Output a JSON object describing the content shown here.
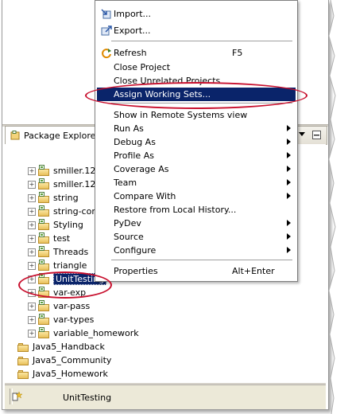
{
  "package_explorer": {
    "tab_label": "Package Explorer",
    "projects": [
      {
        "label": "smiller.12V",
        "type": "pydev"
      },
      {
        "label": "smiller.12V",
        "type": "pydev"
      },
      {
        "label": "string",
        "type": "java"
      },
      {
        "label": "string-cor",
        "type": "java"
      },
      {
        "label": "Styling",
        "type": "java"
      },
      {
        "label": "test",
        "type": "pydev"
      },
      {
        "label": "Threads",
        "type": "java"
      },
      {
        "label": "triangle",
        "type": "java"
      },
      {
        "label": "UnitTesting",
        "type": "java",
        "selected": true
      },
      {
        "label": "var-exp",
        "type": "java"
      },
      {
        "label": "var-pass",
        "type": "java"
      },
      {
        "label": "var-types",
        "type": "java"
      },
      {
        "label": "variable_homework",
        "type": "java"
      }
    ],
    "working_sets": [
      "Java5_Handback",
      "Java5_Community",
      "Java5_Homework"
    ]
  },
  "status_bar": {
    "text": "UnitTesting"
  },
  "context_menu": {
    "items": [
      {
        "label": "Import...",
        "icon": "import-icon"
      },
      {
        "label": "Export...",
        "icon": "export-icon"
      },
      {
        "label": "Refresh",
        "shortcut": "F5",
        "icon": "refresh-icon"
      },
      {
        "label": "Close Project"
      },
      {
        "label": "Close Unrelated Projects"
      },
      {
        "label": "Assign Working Sets...",
        "highlighted": true
      },
      {
        "label": "Show in Remote Systems view"
      },
      {
        "label": "Run As",
        "submenu": true
      },
      {
        "label": "Debug As",
        "submenu": true
      },
      {
        "label": "Profile As",
        "submenu": true
      },
      {
        "label": "Coverage As",
        "submenu": true
      },
      {
        "label": "Team",
        "submenu": true
      },
      {
        "label": "Compare With",
        "submenu": true
      },
      {
        "label": "Restore from Local History..."
      },
      {
        "label": "PyDev",
        "submenu": true
      },
      {
        "label": "Source",
        "submenu": true
      },
      {
        "label": "Configure",
        "submenu": true
      },
      {
        "label": "Properties",
        "shortcut": "Alt+Enter"
      }
    ]
  },
  "colors": {
    "selection": "#0a246a",
    "annotation_ring": "#c8102e"
  }
}
